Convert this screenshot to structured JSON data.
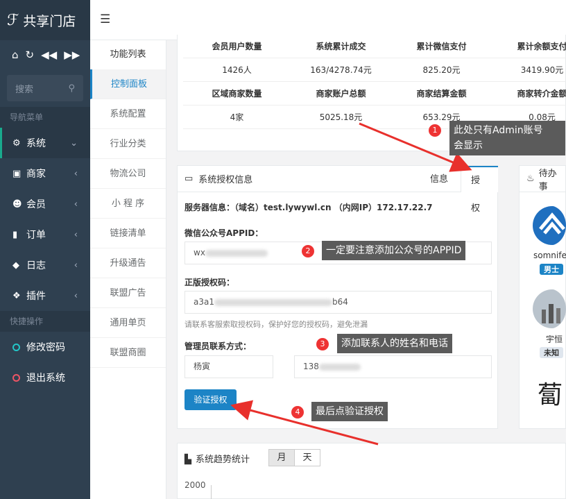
{
  "brand": {
    "logo_text": "共享门店"
  },
  "sidebar": {
    "search_placeholder": "搜索",
    "nav_section": "导航菜单",
    "items": [
      {
        "label": "系统",
        "icon": "gear-icon"
      },
      {
        "label": "商家",
        "icon": "briefcase-icon"
      },
      {
        "label": "会员",
        "icon": "users-icon"
      },
      {
        "label": "订单",
        "icon": "bookmark-icon"
      },
      {
        "label": "日志",
        "icon": "shield-icon"
      },
      {
        "label": "插件",
        "icon": "cubes-icon"
      }
    ],
    "quick_section": "快捷操作",
    "quick_items": [
      {
        "label": "修改密码",
        "color": "#23c6c8"
      },
      {
        "label": "退出系统",
        "color": "#ed5565"
      }
    ]
  },
  "submenu": {
    "title": "功能列表",
    "items": [
      "控制面板",
      "系统配置",
      "行业分类",
      "物流公司",
      "小 程 序",
      "链接清单",
      "升级通告",
      "联盟广告",
      "通用单页",
      "联盟商圈"
    ]
  },
  "stats": {
    "headers1": [
      "会员用户数量",
      "系统累计成交",
      "累计微信支付",
      "累计余额支付"
    ],
    "values1": [
      "1426人",
      "163/4278.74元",
      "825.20元",
      "3419.90元"
    ],
    "headers2": [
      "区域商家数量",
      "商家账户总额",
      "商家结算金额",
      "商家转介金额"
    ],
    "values2": [
      "4家",
      "5025.18元",
      "653.29元",
      "0.08元"
    ]
  },
  "auth": {
    "title": "系统授权信息",
    "tab_info": "信息",
    "tab_auth": "授权",
    "server_info": "服务器信息：（域名）test.lywywl.cn （内网IP）172.17.22.7",
    "appid_label": "微信公众号APPID：",
    "appid_value": "wx",
    "code_label": "正版授权码：",
    "code_value": "a3a1",
    "code_tail": "b64",
    "hint": "请联系客服索取授权码，保护好您的授权码，避免泄漏",
    "contact_label": "管理员联系方式：",
    "contact_name": "杨寅",
    "contact_phone": "138",
    "verify_button": "验证授权"
  },
  "todo": {
    "title": "待办事"
  },
  "users": [
    {
      "name": "somnife.",
      "badge": "男士"
    },
    {
      "name": "宇恒",
      "badge": "未知"
    }
  ],
  "trend": {
    "title": "系统趋势统计",
    "tab_month": "月",
    "tab_day": "天",
    "y_tick": "2000"
  },
  "callouts": [
    {
      "num": "1",
      "text": "此处只有Admin账号\n会显示"
    },
    {
      "num": "2",
      "text": "一定要注意添加公众号的APPID"
    },
    {
      "num": "3",
      "text": "添加联系人的姓名和电话"
    },
    {
      "num": "4",
      "text": "最后点验证授权"
    }
  ]
}
